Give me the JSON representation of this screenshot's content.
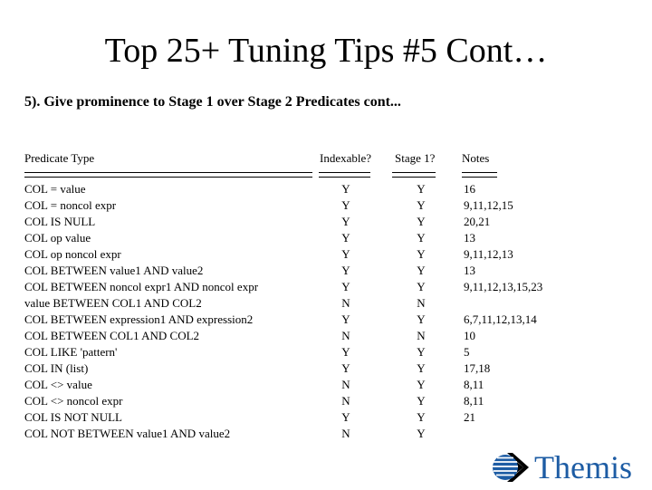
{
  "slide": {
    "title": "Top 25+ Tuning Tips #5 Cont…",
    "subtitle": "5). Give prominence to Stage 1 over Stage 2 Predicates cont..."
  },
  "table": {
    "headers": {
      "predicate_type": "Predicate Type",
      "indexable": "Indexable?",
      "stage1": "Stage 1?",
      "notes": "Notes"
    },
    "rows": [
      {
        "predicate": "COL = value",
        "indexable": "Y",
        "stage1": "Y",
        "notes": "16"
      },
      {
        "predicate": "COL = noncol expr",
        "indexable": "Y",
        "stage1": "Y",
        "notes": "9,11,12,15"
      },
      {
        "predicate": "COL IS NULL",
        "indexable": "Y",
        "stage1": "Y",
        "notes": "20,21"
      },
      {
        "predicate": "COL op value",
        "indexable": "Y",
        "stage1": "Y",
        "notes": "13"
      },
      {
        "predicate": "COL op noncol expr",
        "indexable": "Y",
        "stage1": "Y",
        "notes": "9,11,12,13"
      },
      {
        "predicate": "COL BETWEEN value1 AND value2",
        "indexable": "Y",
        "stage1": "Y",
        "notes": "13"
      },
      {
        "predicate": "COL BETWEEN noncol expr1 AND noncol expr",
        "indexable": "Y",
        "stage1": "Y",
        "notes": "9,11,12,13,15,23"
      },
      {
        "predicate": "value BETWEEN COL1 AND COL2",
        "indexable": "N",
        "stage1": "N",
        "notes": ""
      },
      {
        "predicate": "COL BETWEEN expression1 AND expression2",
        "indexable": "Y",
        "stage1": "Y",
        "notes": "6,7,11,12,13,14"
      },
      {
        "predicate": "COL BETWEEN COL1 AND COL2",
        "indexable": "N",
        "stage1": "N",
        "notes": "10"
      },
      {
        "predicate": "COL LIKE 'pattern'",
        "indexable": "Y",
        "stage1": "Y",
        "notes": "5"
      },
      {
        "predicate": "COL IN (list)",
        "indexable": "Y",
        "stage1": "Y",
        "notes": "17,18"
      },
      {
        "predicate": "COL <> value",
        "indexable": "N",
        "stage1": "Y",
        "notes": "8,11"
      },
      {
        "predicate": "COL <> noncol expr",
        "indexable": "N",
        "stage1": "Y",
        "notes": "8,11"
      },
      {
        "predicate": "COL IS NOT NULL",
        "indexable": "Y",
        "stage1": "Y",
        "notes": "21"
      },
      {
        "predicate": "COL NOT BETWEEN value1 AND value2",
        "indexable": "N",
        "stage1": "Y",
        "notes": ""
      }
    ]
  },
  "logo": {
    "wordmark": "Themis",
    "mark_icon": "themis-globe-arrow-icon",
    "brand_color": "#1d5ca4",
    "arrow_color": "#000000"
  }
}
